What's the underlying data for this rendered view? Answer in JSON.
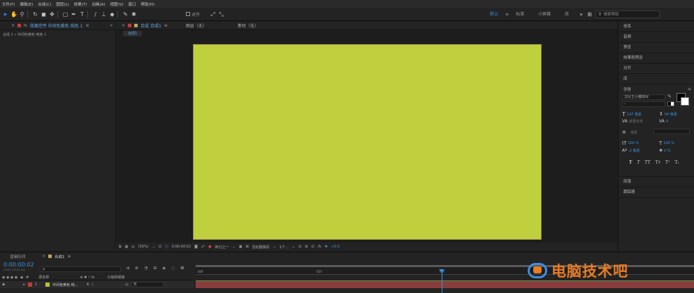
{
  "menu": [
    "文件(F)",
    "编辑(E)",
    "合成(C)",
    "图层(L)",
    "效果(T)",
    "动画(A)",
    "视图(V)",
    "窗口",
    "帮助(H)"
  ],
  "toolbar": {
    "align_label": "对齐",
    "workspaces": [
      "默认",
      "标准",
      "小屏幕",
      "库"
    ],
    "active_workspace": "默认",
    "search_placeholder": "搜索帮助"
  },
  "left_panel": {
    "tab_label": "效果控件 中间色黄色 纯色 1",
    "breadcrumb": "合成 1 • 中间色黄色 纯色 1"
  },
  "viewer": {
    "tab_label": "合成 合成1",
    "other_tabs": [
      "图层（无）",
      "素材（无）"
    ],
    "comp_chip": "合成1",
    "solid_color": "#c0cf3d",
    "bottom_bar": {
      "zoom": "(50%)",
      "timecode": "0:00:00:02",
      "resolution": "四分之一",
      "camera": "活动摄像机",
      "views": "1个...",
      "offset": "+0.0"
    }
  },
  "right_panel": {
    "items": [
      "信息",
      "音频",
      "预览",
      "效果和预设",
      "对齐",
      "库"
    ],
    "character": {
      "title": "字符",
      "font_name": "汉仪王小楷体W",
      "font_style": "-",
      "size": "147 像素",
      "leading": "94 像素",
      "kerning": "度量标准",
      "tracking": "0",
      "stroke": "- 像素",
      "vscale": "100 %",
      "hscale": "100 %",
      "baseline": "-2 像素",
      "tsume": "0 %",
      "style_buttons": [
        "T",
        "T",
        "TT",
        "Tт",
        "T¹",
        "T₁"
      ]
    },
    "bottom_items": [
      "段落",
      "跟踪器"
    ]
  },
  "timeline": {
    "render_tab": "渲染队列",
    "comp_tab": "合成1",
    "timecode": "0:00:00:02",
    "timecode_sub": "00002 (25.00 fps)",
    "search_placeholder": "ρ.",
    "col_source": "源名称",
    "col_parent": "父级和链接",
    "layer_number": "1",
    "layer_name": "中间色黄色 纯...",
    "parent_value": "无",
    "ruler": [
      "00f",
      "01f",
      "02f"
    ],
    "watermark": "电脑技术吧"
  }
}
